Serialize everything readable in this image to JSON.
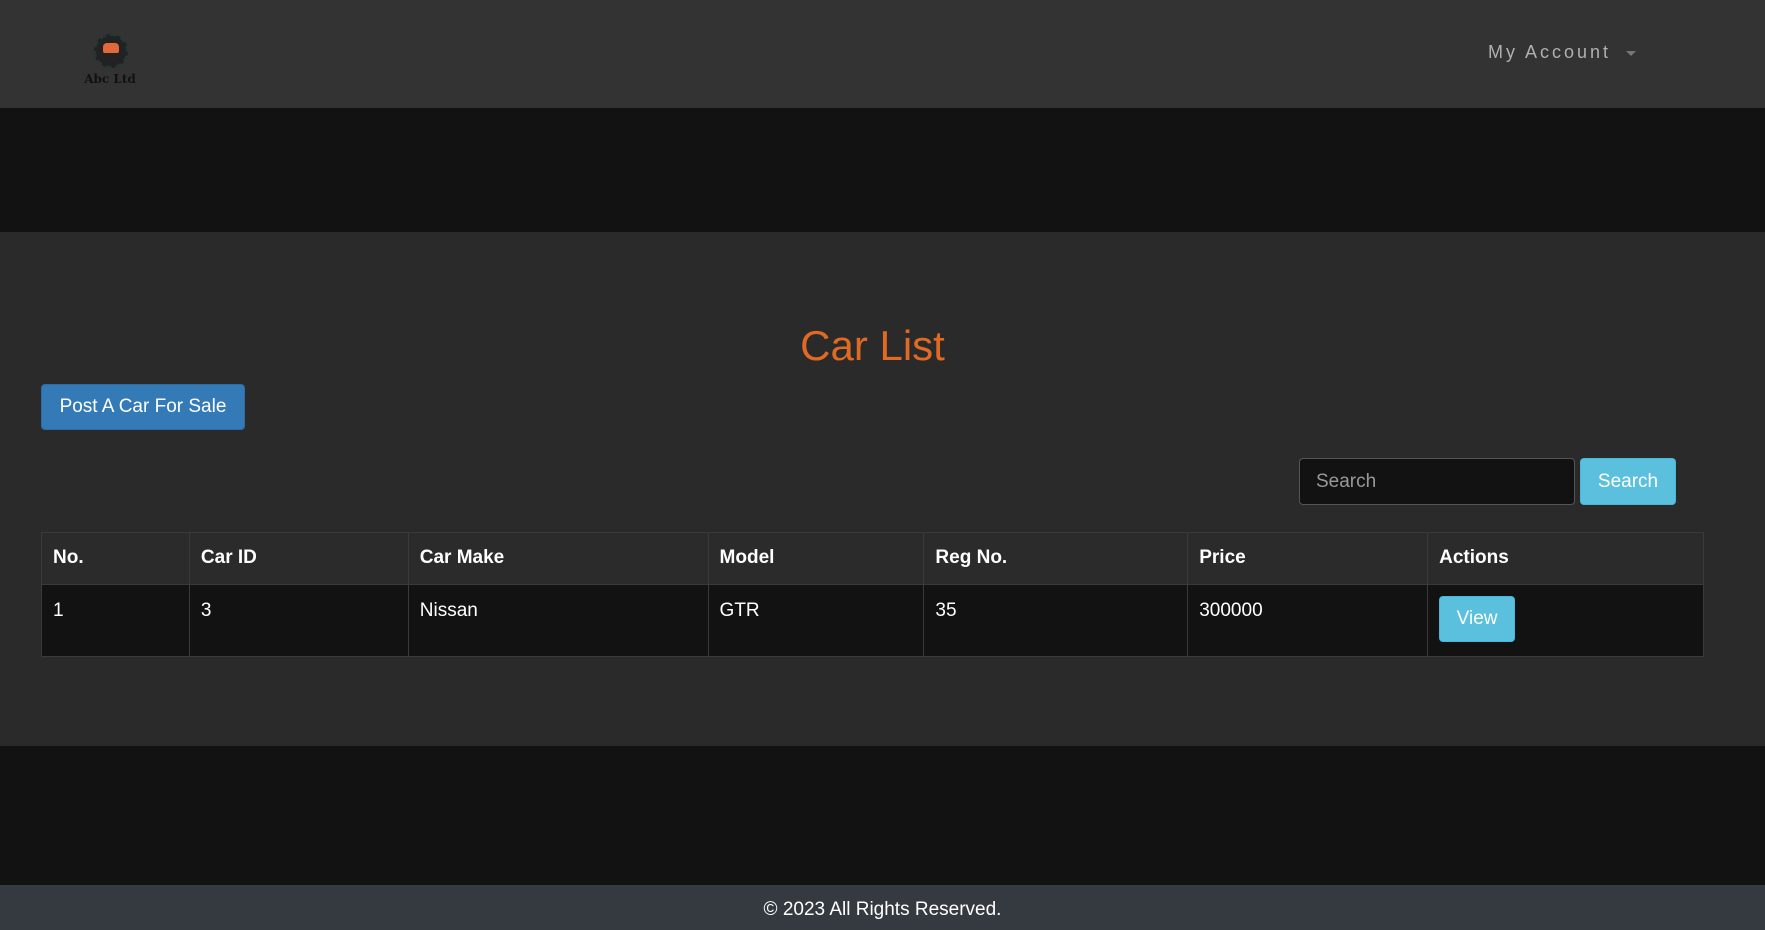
{
  "header": {
    "logo_text": "Abc Ltd",
    "account_label": "My Account"
  },
  "main": {
    "title": "Car List",
    "post_button_label": "Post A Car For Sale",
    "search": {
      "placeholder": "Search",
      "value": "",
      "button_label": "Search"
    },
    "table": {
      "columns": [
        "No.",
        "Car ID",
        "Car Make",
        "Model",
        "Reg No.",
        "Price",
        "Actions"
      ],
      "rows": [
        {
          "no": "1",
          "car_id": "3",
          "make": "Nissan",
          "model": "GTR",
          "reg_no": "35",
          "price": "300000",
          "action_label": "View"
        }
      ]
    }
  },
  "footer": {
    "copyright": "© 2023 All Rights Reserved."
  },
  "colors": {
    "title": "#e06a23",
    "primary_button": "#337ab7",
    "info_button": "#5bc0de"
  }
}
